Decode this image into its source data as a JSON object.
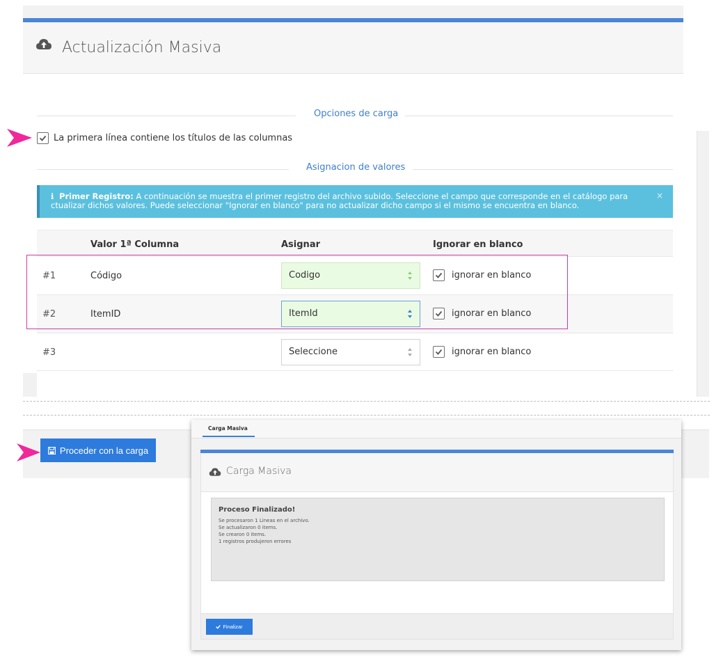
{
  "page": {
    "title": "Actualización Masiva",
    "icon": "cloud-upload-icon"
  },
  "options": {
    "legend": "Opciones de carga",
    "first_line_titles": {
      "label": "La primera línea contiene los títulos de las columnas",
      "checked": true
    }
  },
  "assign": {
    "legend": "Asignacion de valores",
    "alert": {
      "title": "Primer Registro:",
      "text": "A continuación se muestra el primer registro del archivo subido. Seleccione el campo que corresponde en el catálogo para ctualizar dichos valores. Puede seleccionar \"Ignorar en blanco\" para no actualizar dicho campo si el mismo se encuentra en blanco.",
      "close": "×"
    },
    "columns": {
      "value": "Valor 1ª Columna",
      "assign": "Asignar",
      "ignore": "Ignorar en blanco"
    },
    "rows": [
      {
        "num": "#1",
        "value": "Código",
        "select": "Codigo",
        "ignore_label": "ignorar en blanco",
        "ignore_checked": true
      },
      {
        "num": "#2",
        "value": "ItemID",
        "select": "ItemId",
        "ignore_label": "ignorar en blanco",
        "ignore_checked": true
      },
      {
        "num": "#3",
        "value": "",
        "select": "Seleccione",
        "ignore_label": "ignorar en blanco",
        "ignore_checked": true
      }
    ]
  },
  "actions": {
    "proceed_label": "Proceder con la carga"
  },
  "popup": {
    "tab_label": "Carga Masiva",
    "title": "Carga Masiva",
    "result": {
      "title": "Proceso Finalizado!",
      "lines": [
        "Se procesaron 1 Lineas en el archivo.",
        "Se actualizaron 0 items.",
        "Se crearon 0 items.",
        "1 registros produjeron errores"
      ]
    },
    "finish_label": "Finalizar"
  },
  "colors": {
    "accent": "#4a86d8",
    "button": "#2d7bdc",
    "alert": "#5bc0de",
    "highlight": "#cc3aa8",
    "pointer": "#f0289a"
  }
}
